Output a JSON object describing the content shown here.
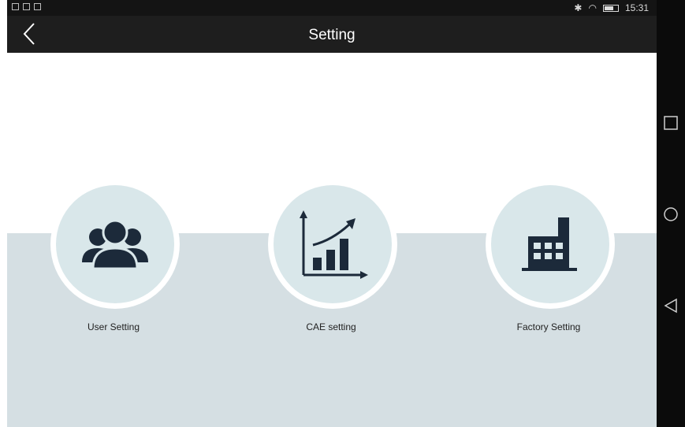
{
  "status_bar": {
    "time": "15:31"
  },
  "header": {
    "title": "Setting"
  },
  "icons": {
    "back": "chevron-left-icon",
    "user": "users-group-icon",
    "cae": "growth-chart-icon",
    "factory": "factory-icon"
  },
  "cards": [
    {
      "label": "User Setting"
    },
    {
      "label": "CAE setting"
    },
    {
      "label": "Factory Setting"
    }
  ],
  "colors": {
    "title_bar": "#1e1e1e",
    "band": "#d5dfe3",
    "icon_circle": "#d9e7ea",
    "icon_fill": "#1c2a3a"
  }
}
